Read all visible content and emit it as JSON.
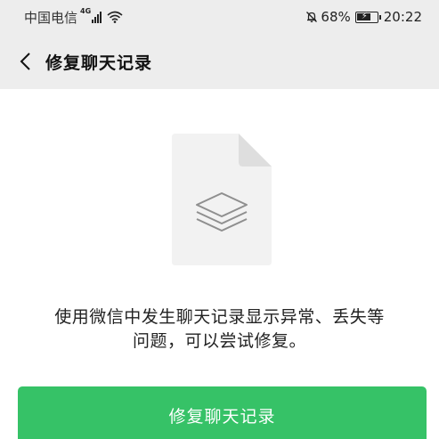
{
  "status_bar": {
    "carrier": "中国电信",
    "network_type": "4G",
    "battery_percent": "68%",
    "battery_level": 0.68,
    "time": "20:22",
    "icons": [
      "signal-icon",
      "wifi-icon",
      "mute-bell-icon",
      "battery-icon"
    ]
  },
  "nav": {
    "back_icon": "chevron-left-icon",
    "title": "修复聊天记录"
  },
  "illustration": {
    "icon": "document-layers-icon"
  },
  "content": {
    "message_line1": "使用微信中发生聊天记录显示异常、丢失等",
    "message_line2": "问题，可以尝试修复。"
  },
  "actions": {
    "repair_button_label": "修复聊天记录"
  },
  "colors": {
    "header_bg": "#ededed",
    "page_bg": "#ffffff",
    "accent": "#36c267",
    "doc_fill": "#f2f2f2",
    "doc_fold": "#dedede",
    "layers_stroke": "#8f8f8f"
  }
}
